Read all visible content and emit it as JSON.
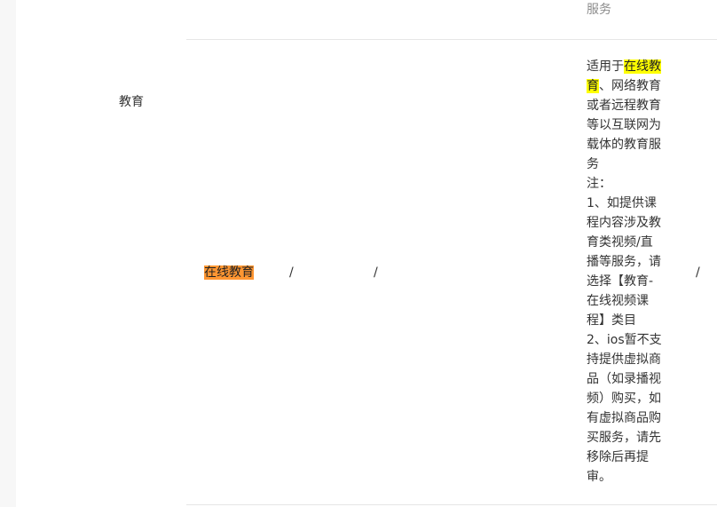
{
  "table": {
    "category": "教育",
    "service": "在线教育",
    "col3": "/",
    "col4": "/",
    "col6": "/",
    "description": {
      "prefix": "适用于",
      "highlight": "在线教育",
      "rest": "、网络教育或者远程教育等以互联网为载体的教育服务\n注：\n1、如提供课程内容涉及教育类视频/直播等服务，请选择【教育-在线视频课程】类目\n2、ios暂不支持提供虚拟商品（如录播视频）购买，如有虚拟商品购买服务，请先移除后再提审。"
    }
  },
  "colors": {
    "service_highlight": "#ff9632",
    "keyword_highlight": "#ffff00"
  }
}
